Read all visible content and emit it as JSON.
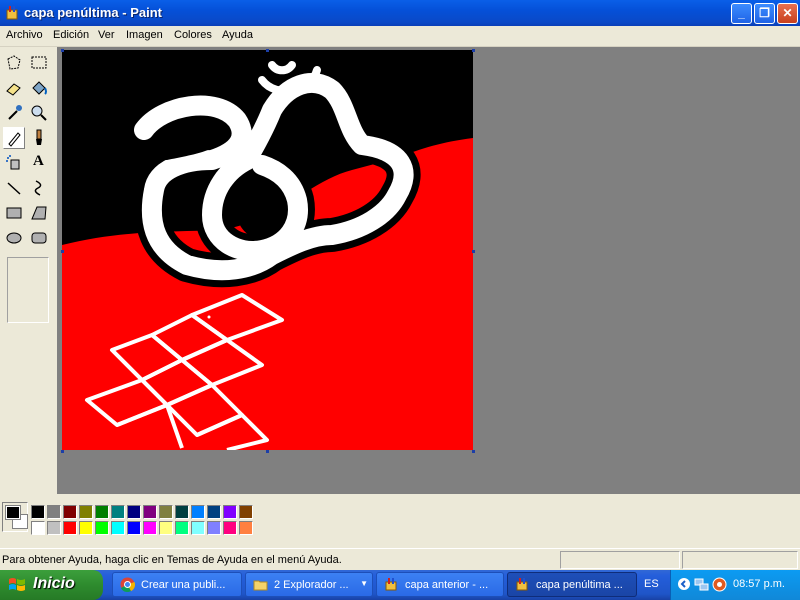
{
  "window": {
    "title": "capa penúltima - Paint",
    "controls": {
      "minimize": "_",
      "maximize": "❐",
      "close": "✕"
    }
  },
  "menu": [
    "Archivo",
    "Edición",
    "Ver",
    "Imagen",
    "Colores",
    "Ayuda"
  ],
  "toolbox": {
    "tools": [
      "free-form-select-icon",
      "select-icon",
      "eraser-icon",
      "fill-icon",
      "pick-color-icon",
      "magnifier-icon",
      "pencil-icon",
      "brush-icon",
      "airbrush-icon",
      "text-icon",
      "line-icon",
      "curve-icon",
      "rectangle-icon",
      "polygon-icon",
      "ellipse-icon",
      "rounded-rectangle-icon"
    ],
    "active_tool": "pencil-icon",
    "text_tool_glyph": "A"
  },
  "palette": {
    "foreground": "#000000",
    "background": "#ffffff",
    "row1": [
      "#000000",
      "#808080",
      "#800000",
      "#808000",
      "#008000",
      "#008080",
      "#000080",
      "#800080",
      "#808040",
      "#004040",
      "#0080ff",
      "#004080",
      "#8000ff",
      "#804000"
    ],
    "row2": [
      "#ffffff",
      "#c0c0c0",
      "#ff0000",
      "#ffff00",
      "#00ff00",
      "#00ffff",
      "#0000ff",
      "#ff00ff",
      "#ffff80",
      "#00ff80",
      "#80ffff",
      "#8080ff",
      "#ff0080",
      "#ff8040"
    ]
  },
  "status": {
    "help_text": "Para obtener Ayuda, haga clic en Temas de Ayuda en el menú Ayuda."
  },
  "taskbar": {
    "start_label": "Inicio",
    "tasks": [
      {
        "label": "Crear una publi...",
        "icon": "chrome-icon",
        "active": false
      },
      {
        "label": "2 Explorador ...",
        "icon": "folder-icon",
        "active": false
      },
      {
        "label": "capa anterior - ...",
        "icon": "paint-icon",
        "active": false
      },
      {
        "label": "capa penúltima ...",
        "icon": "paint-icon",
        "active": true
      }
    ],
    "language": "ES",
    "clock": "08:57 p.m."
  },
  "colors": {
    "titlebar": "#0a5fe8",
    "canvas_red": "#ff0000",
    "canvas_black": "#000000",
    "workspace": "#808080"
  }
}
